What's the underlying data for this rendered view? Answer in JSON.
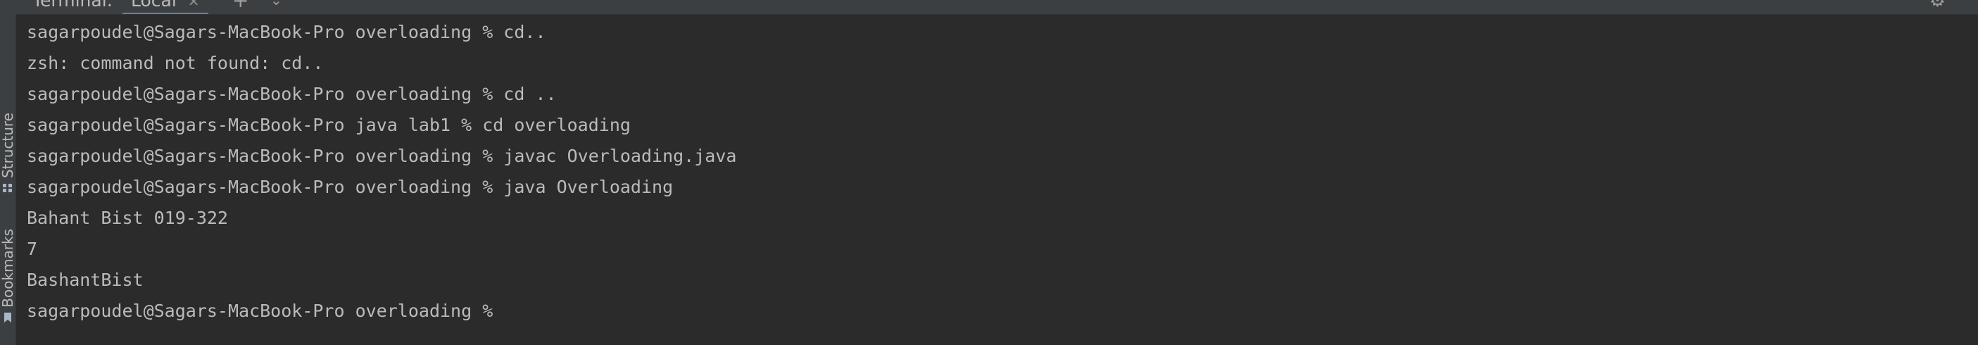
{
  "tool_window": {
    "title": "Terminal:",
    "tab_label": "Local",
    "tab_close_glyph": "✕",
    "add_tab_glyph": "+",
    "menu_glyph": "⌄",
    "settings_glyph": "⚙"
  },
  "side_stripe": {
    "structure_label": "Structure",
    "bookmarks_label": "Bookmarks"
  },
  "terminal": {
    "lines": [
      "sagarpoudel@Sagars-MacBook-Pro overloading % cd..",
      "zsh: command not found: cd..",
      "sagarpoudel@Sagars-MacBook-Pro overloading % cd ..",
      "sagarpoudel@Sagars-MacBook-Pro java lab1 % cd overloading",
      "sagarpoudel@Sagars-MacBook-Pro overloading % javac Overloading.java",
      "sagarpoudel@Sagars-MacBook-Pro overloading % java Overloading",
      "Bahant Bist 019-322",
      "7",
      "BashantBist",
      "sagarpoudel@Sagars-MacBook-Pro overloading % "
    ]
  },
  "colors": {
    "background": "#2b2b2b",
    "text": "#bbbbbb",
    "accent": "#4a88c7"
  },
  "icons": {
    "structure": "structure-icon",
    "bookmarks": "bookmark-icon",
    "settings": "gear-icon",
    "add": "plus-icon",
    "close": "close-icon",
    "menu": "chevron-down-icon"
  }
}
